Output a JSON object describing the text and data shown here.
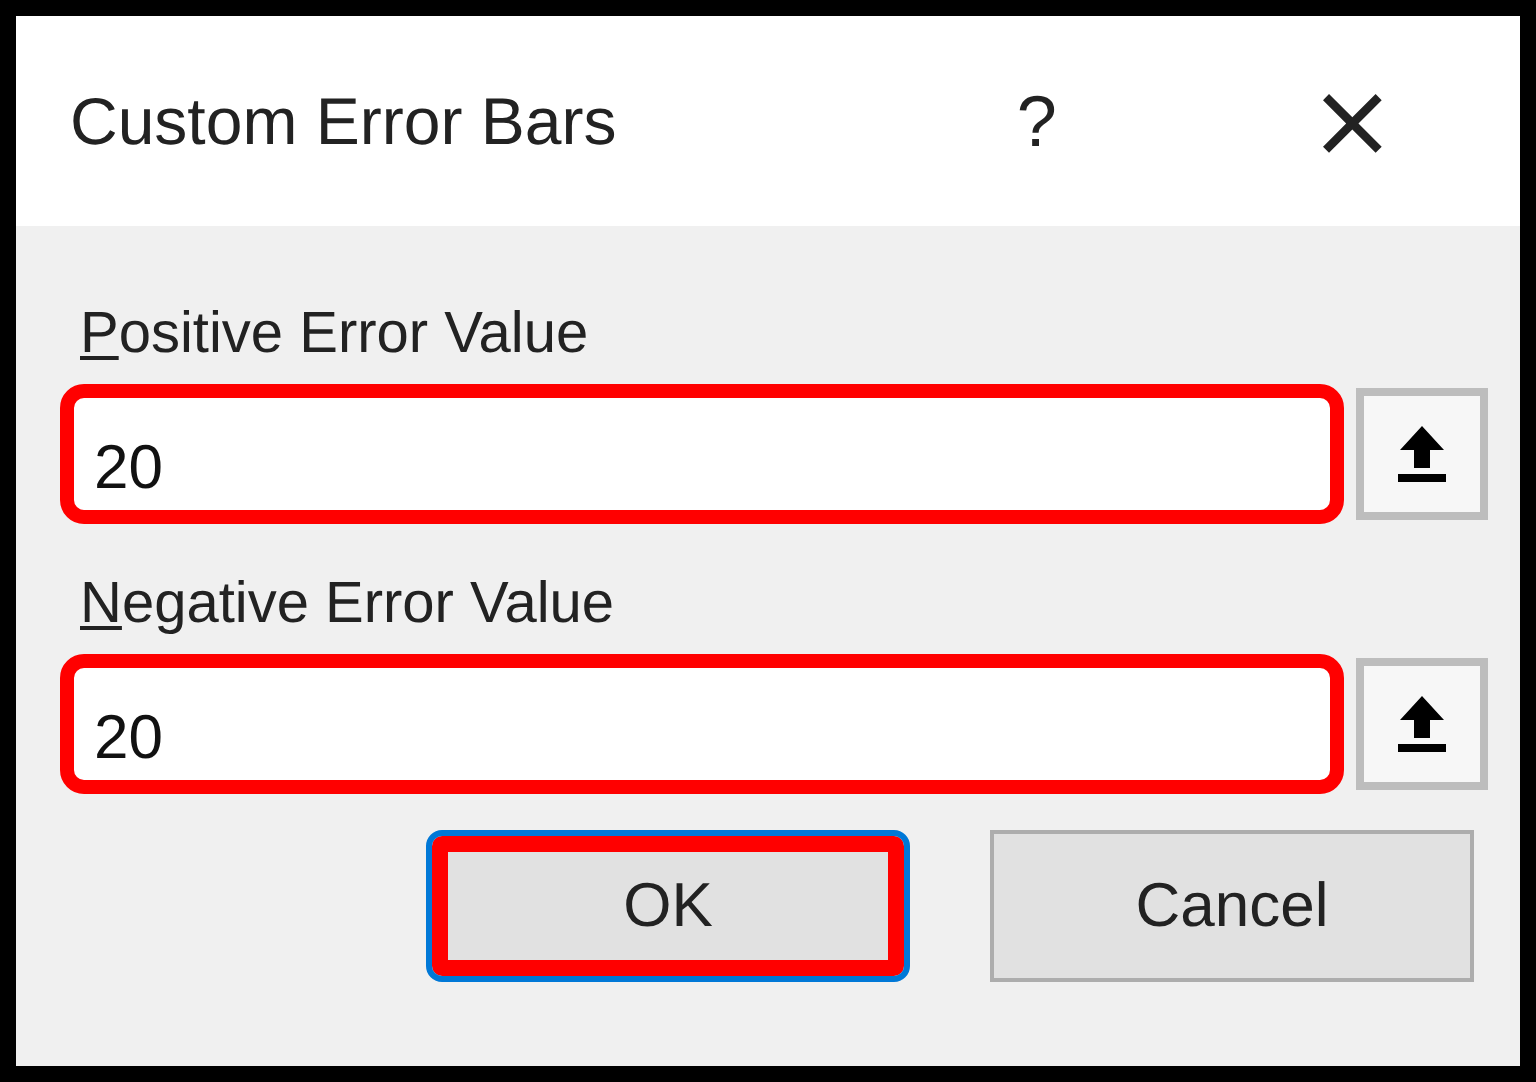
{
  "window": {
    "title": "Custom Error Bars",
    "help": "?",
    "close": "×"
  },
  "fields": [
    {
      "label": "Positive Error Value",
      "underline_first": true,
      "value": "20",
      "highlighted": true
    },
    {
      "label": "Negative Error Value",
      "underline_first": true,
      "value": "20",
      "highlighted": true
    }
  ],
  "buttons": [
    {
      "label": "OK",
      "default": true,
      "highlighted": true
    },
    {
      "label": "Cancel",
      "default": false,
      "highlighted": false
    }
  ]
}
